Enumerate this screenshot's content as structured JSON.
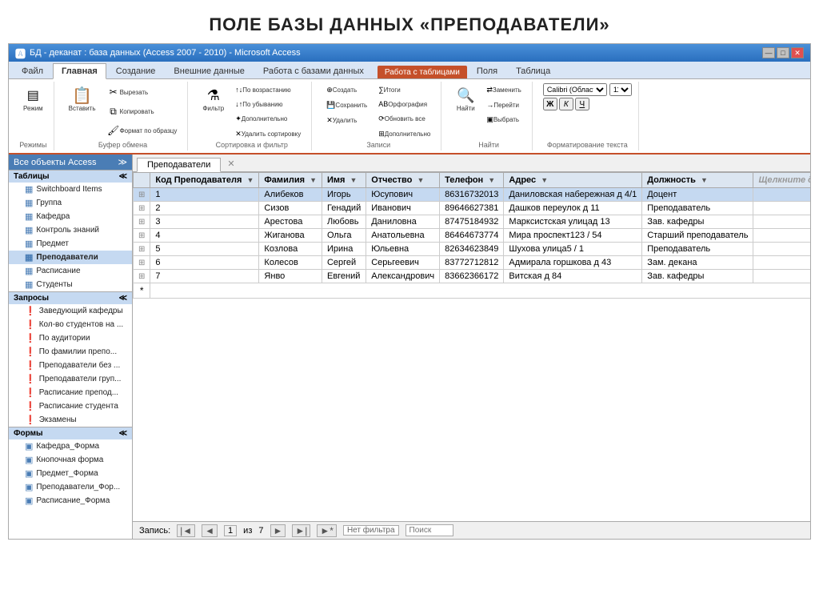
{
  "pageTitle": "ПОЛЕ БАЗЫ ДАННЫХ «ПРЕПОДАВАТЕЛИ»",
  "titleBar": {
    "title": "БД - деканат : база данных (Access 2007 - 2010) - Microsoft Access",
    "icon": "🅰",
    "controls": [
      "—",
      "□",
      "✕"
    ]
  },
  "ribbonTabs": [
    {
      "label": "Файл",
      "active": false
    },
    {
      "label": "Главная",
      "active": true
    },
    {
      "label": "Создание",
      "active": false
    },
    {
      "label": "Внешние данные",
      "active": false
    },
    {
      "label": "Работа с базами данных",
      "active": false
    },
    {
      "label": "Работа с таблицами",
      "extra": true
    },
    {
      "label": "Поля",
      "active": false
    },
    {
      "label": "Таблица",
      "active": false
    }
  ],
  "ribbonGroups": [
    {
      "label": "Режимы",
      "buttons": [
        {
          "icon": "▤",
          "label": "Режим"
        }
      ]
    },
    {
      "label": "Буфер обмена",
      "buttons": [
        {
          "icon": "📋",
          "label": "Вставить"
        },
        {
          "icon": "✂",
          "label": "Вырезать"
        },
        {
          "icon": "⧉",
          "label": "Копировать"
        },
        {
          "icon": "🖌",
          "label": "Формат по образцу"
        }
      ]
    },
    {
      "label": "Сортировка и фильтр",
      "buttons": [
        {
          "icon": "⚗",
          "label": "Фильтр"
        },
        {
          "icon": "↑",
          "label": "По возрастанию"
        },
        {
          "icon": "↓",
          "label": "По убыванию"
        },
        {
          "icon": "✦",
          "label": "Дополнительно"
        },
        {
          "icon": "✕",
          "label": "Удалить сортировку"
        }
      ]
    },
    {
      "label": "Записи",
      "buttons": [
        {
          "icon": "⊕",
          "label": "Создать"
        },
        {
          "icon": "💾",
          "label": "Сохранить"
        },
        {
          "icon": "✕",
          "label": "Удалить"
        },
        {
          "icon": "∑",
          "label": "Итоги"
        },
        {
          "icon": "АВ",
          "label": "Орфография"
        },
        {
          "icon": "⊞",
          "label": "Обновить все"
        },
        {
          "icon": "⊞",
          "label": "Дополнительно"
        }
      ]
    },
    {
      "label": "Найти",
      "buttons": [
        {
          "icon": "🔍",
          "label": "Найти"
        },
        {
          "icon": "⇄",
          "label": "Заменить"
        },
        {
          "icon": "→",
          "label": "Перейти"
        },
        {
          "icon": "▣",
          "label": "Выбрать"
        }
      ]
    },
    {
      "label": "Форматирование текста",
      "buttons": [
        {
          "icon": "B",
          "label": "Ж"
        },
        {
          "icon": "I",
          "label": "К"
        },
        {
          "icon": "U",
          "label": "Ч"
        }
      ]
    }
  ],
  "navPane": {
    "header": "Все объекты Access",
    "sections": [
      {
        "label": "Таблицы",
        "items": [
          {
            "label": "Switchboard Items",
            "icon": "▦",
            "active": false
          },
          {
            "label": "Группа",
            "icon": "▦",
            "active": false
          },
          {
            "label": "Кафедра",
            "icon": "▦",
            "active": false
          },
          {
            "label": "Контроль знаний",
            "icon": "▦",
            "active": false
          },
          {
            "label": "Предмет",
            "icon": "▦",
            "active": false
          },
          {
            "label": "Преподаватели",
            "icon": "▦",
            "active": true
          },
          {
            "label": "Расписание",
            "icon": "▦",
            "active": false
          },
          {
            "label": "Студенты",
            "icon": "▦",
            "active": false
          }
        ]
      },
      {
        "label": "Запросы",
        "items": [
          {
            "label": "Заведующий кафедры",
            "icon": "❗",
            "active": false
          },
          {
            "label": "Кол-во студентов на ...",
            "icon": "❗",
            "active": false
          },
          {
            "label": "По аудитории",
            "icon": "❗",
            "active": false
          },
          {
            "label": "По фамилии препо...",
            "icon": "❗",
            "active": false
          },
          {
            "label": "Преподаватели без ...",
            "icon": "❗",
            "active": false
          },
          {
            "label": "Преподаватели груп...",
            "icon": "❗",
            "active": false
          },
          {
            "label": "Расписание препод...",
            "icon": "❗",
            "active": false
          },
          {
            "label": "Расписание студента",
            "icon": "❗",
            "active": false
          },
          {
            "label": "Экзамены",
            "icon": "❗",
            "active": false
          }
        ]
      },
      {
        "label": "Формы",
        "items": [
          {
            "label": "Кафедра_Форма",
            "icon": "▣",
            "active": false
          },
          {
            "label": "Кнопочная форма",
            "icon": "▣",
            "active": false
          },
          {
            "label": "Предмет_Форма",
            "icon": "▣",
            "active": false
          },
          {
            "label": "Преподаватели_Фор...",
            "icon": "▣",
            "active": false
          },
          {
            "label": "Расписание_Форма",
            "icon": "▣",
            "active": false
          }
        ]
      }
    ]
  },
  "tableTab": "Преподаватели",
  "tableColumns": [
    {
      "label": "Код Преподавателя",
      "sortable": true
    },
    {
      "label": "Фамилия",
      "sortable": true
    },
    {
      "label": "Имя",
      "sortable": true
    },
    {
      "label": "Отчество",
      "sortable": true
    },
    {
      "label": "Телефон",
      "sortable": true
    },
    {
      "label": "Адрес",
      "sortable": true
    },
    {
      "label": "Должность",
      "sortable": true
    },
    {
      "label": "Щелкните для добавл...",
      "sortable": false
    }
  ],
  "tableRows": [
    {
      "id": 1,
      "selected": true,
      "fam": "Алибеков",
      "imya": "Игорь",
      "otch": "Юсупович",
      "tel": "86316732013",
      "adres": "Даниловская набережная д 4/1",
      "dolzh": "Доцент"
    },
    {
      "id": 2,
      "selected": false,
      "fam": "Сизов",
      "imya": "Генадий",
      "otch": "Иванович",
      "tel": "89646627381",
      "adres": "Дашков переулок д 11",
      "dolzh": "Преподаватель"
    },
    {
      "id": 3,
      "selected": false,
      "fam": "Арестова",
      "imya": "Любовь",
      "otch": "Даниловна",
      "tel": "87475184932",
      "adres": "Марксистская улицад 13",
      "dolzh": "Зав. кафедры"
    },
    {
      "id": 4,
      "selected": false,
      "fam": "Жиганова",
      "imya": "Ольга",
      "otch": "Анатольевна",
      "tel": "86464673774",
      "adres": "Мира проспект123 / 54",
      "dolzh": "Старший преподаватель"
    },
    {
      "id": 5,
      "selected": false,
      "fam": "Козлова",
      "imya": "Ирина",
      "otch": "Юльевна",
      "tel": "82634623849",
      "adres": "Шухова улица5 / 1",
      "dolzh": "Преподаватель"
    },
    {
      "id": 6,
      "selected": false,
      "fam": "Колесов",
      "imya": "Сергей",
      "otch": "Серьгеевич",
      "tel": "83772712812",
      "adres": "Адмирала горшкова д 43",
      "dolzh": "Зам. декана"
    },
    {
      "id": 7,
      "selected": false,
      "fam": "Янво",
      "imya": "Евгений",
      "otch": "Александрович",
      "tel": "83662366172",
      "adres": "Витская д 84",
      "dolzh": "Зав. кафедры"
    }
  ],
  "statusBar": {
    "recordLabel": "Запись:",
    "current": "1",
    "total": "7",
    "filterLabel": "Нет фильтра",
    "searchLabel": "Поиск"
  }
}
